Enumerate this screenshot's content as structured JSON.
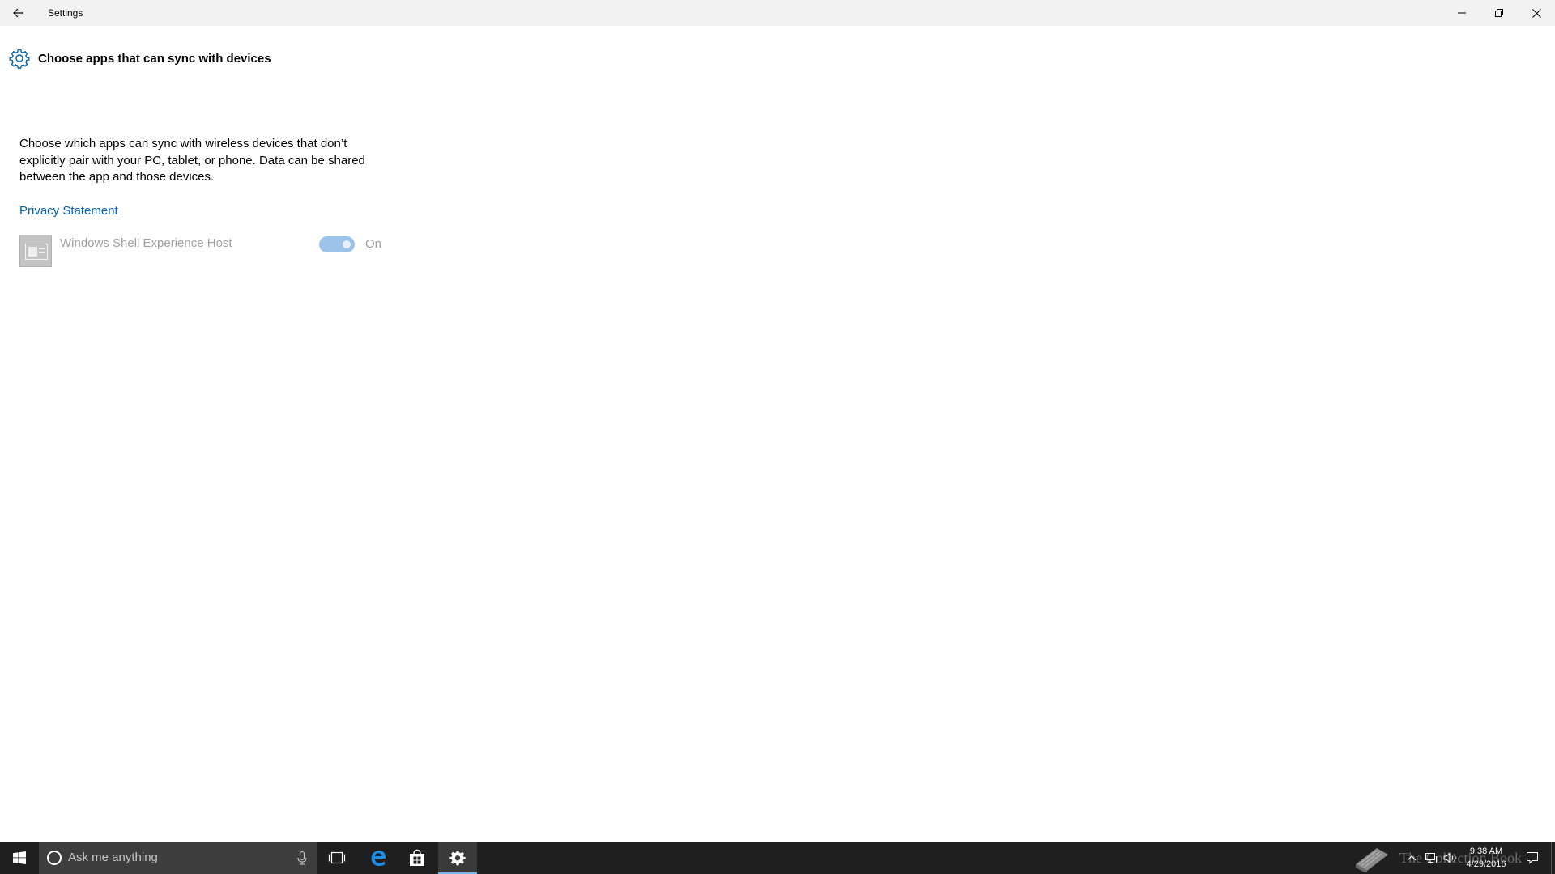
{
  "window": {
    "title": "Settings",
    "back_icon": "back-arrow-icon",
    "minimize_icon": "minimize-icon",
    "maximize_icon": "restore-icon",
    "close_icon": "close-icon"
  },
  "page": {
    "title": "Choose apps that can sync with devices",
    "header_icon": "gear-icon",
    "description": "Choose which apps can sync with wireless devices that don’t explicitly pair with your PC, tablet, or phone. Data can be shared between the app and those devices.",
    "privacy_link": "Privacy Statement",
    "apps": [
      {
        "name": "Windows Shell Experience Host",
        "icon": "app-tile-icon",
        "toggle_state": "On",
        "enabled": true
      }
    ]
  },
  "taskbar": {
    "start_icon": "windows-logo-icon",
    "search_placeholder": "Ask me anything",
    "search_icon": "cortana-circle-icon",
    "mic_icon": "microphone-icon",
    "pinned": [
      {
        "name": "Task View",
        "icon": "task-view-icon"
      },
      {
        "name": "Microsoft Edge",
        "icon": "edge-icon"
      },
      {
        "name": "Store",
        "icon": "store-icon"
      },
      {
        "name": "Settings",
        "icon": "gear-icon",
        "active": true
      }
    ],
    "watermark_text": "The Collection Book",
    "clock_time": "9:38 AM",
    "clock_date": "4/29/2016"
  },
  "colors": {
    "accent": "#0063b1",
    "toggle_on_disabled": "#9cc3ea",
    "taskbar_bg": "#1f1f1f",
    "titlebar_bg": "#f2f2f2"
  }
}
